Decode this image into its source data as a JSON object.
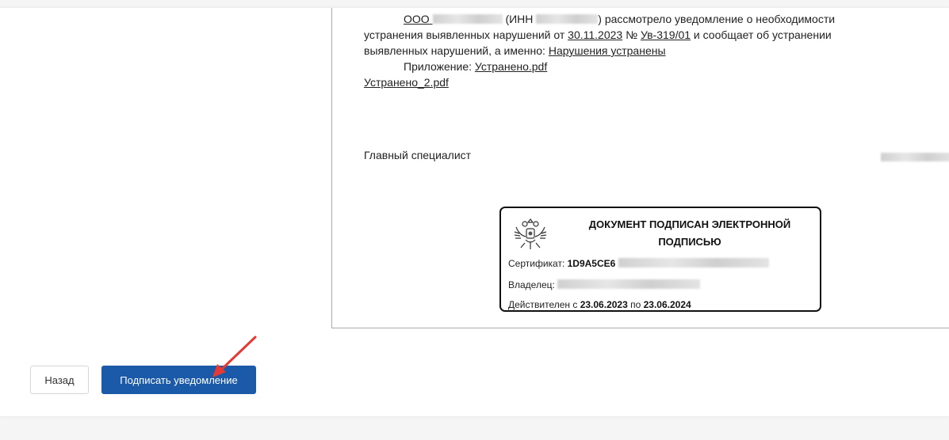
{
  "document": {
    "paragraph1": {
      "org_prefix": "ООО",
      "inn_prefix": "(ИНН",
      "text_after_inn": ") рассмотрело уведомление о необходимости",
      "line2_start": "устранения выявленных нарушений от",
      "date": "30.11.2023",
      "number_sign": "№",
      "number": "Ув-319/01",
      "line2_end": "и сообщает об устранении",
      "line3_start": "выявленных нарушений, а именно:",
      "violations_status": "Нарушения устранены"
    },
    "attachment": {
      "label": "Приложение:",
      "files": [
        "Устранено.pdf",
        "Устранено_2.pdf"
      ]
    },
    "signer_position": "Главный специалист"
  },
  "stamp": {
    "title_line1": "ДОКУМЕНТ ПОДПИСАН ЭЛЕКТРОННОЙ",
    "title_line2": "ПОДПИСЬЮ",
    "certificate_label": "Сертификат:",
    "certificate_value": "1D9A5CE6",
    "owner_label": "Владелец:",
    "validity_prefix": "Действителен с",
    "valid_from": "23.06.2023",
    "validity_middle": "по",
    "valid_to": "23.06.2024"
  },
  "actions": {
    "back_label": "Назад",
    "sign_label": "Подписать уведомление"
  },
  "colors": {
    "primary_button": "#1a5aa8",
    "annotation_arrow": "#e53935"
  }
}
